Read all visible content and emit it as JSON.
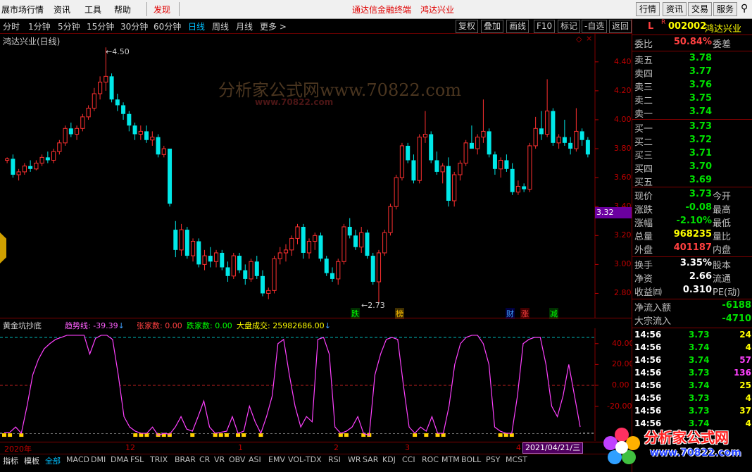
{
  "menu": {
    "items": [
      "展市场行情",
      "资讯",
      "工具",
      "帮助"
    ],
    "discover": "发现",
    "center_links": [
      "通达信金融终端",
      "鸿达兴业"
    ],
    "right_buttons": [
      "行情",
      "资讯",
      "交易",
      "服务"
    ]
  },
  "toolbar": {
    "periods": [
      "分时",
      "1分钟",
      "5分钟",
      "15分钟",
      "30分钟",
      "60分钟",
      "日线",
      "周线",
      "月线",
      "更多 >"
    ],
    "active_period": "日线",
    "right_buttons": [
      "复权",
      "叠加",
      "画线",
      "F10",
      "标记",
      "-自选",
      "返回"
    ]
  },
  "main_chart": {
    "title": "鸿达兴业(日线)",
    "watermark": "分析家公式网www.70822.com",
    "watermark_sub": "www.70822.com",
    "high_label": "4.50",
    "low_label": "2.73",
    "price_marker": "3.32",
    "event_labels": [
      "跌",
      "榜",
      "财",
      "涨",
      "减"
    ],
    "y_ticks": [
      "4.40",
      "4.20",
      "4.00",
      "3.80",
      "3.60",
      "3.40",
      "3.20",
      "3.00",
      "2.80"
    ]
  },
  "chart_data": {
    "type": "candlestick",
    "ylim": [
      2.7,
      4.55
    ],
    "candles": [
      [
        3.72,
        3.74,
        3.7,
        3.73
      ],
      [
        3.73,
        3.76,
        3.6,
        3.62
      ],
      [
        3.62,
        3.66,
        3.58,
        3.64
      ],
      [
        3.64,
        3.7,
        3.62,
        3.68
      ],
      [
        3.68,
        3.72,
        3.64,
        3.66
      ],
      [
        3.66,
        3.72,
        3.65,
        3.7
      ],
      [
        3.7,
        3.76,
        3.68,
        3.74
      ],
      [
        3.74,
        3.78,
        3.7,
        3.72
      ],
      [
        3.72,
        3.8,
        3.7,
        3.78
      ],
      [
        3.78,
        3.86,
        3.76,
        3.84
      ],
      [
        3.84,
        3.96,
        3.82,
        3.94
      ],
      [
        3.94,
        3.98,
        3.88,
        3.9
      ],
      [
        3.9,
        3.96,
        3.86,
        3.94
      ],
      [
        3.94,
        4.04,
        3.92,
        4.02
      ],
      [
        4.02,
        4.1,
        4.0,
        4.08
      ],
      [
        4.08,
        4.22,
        4.06,
        4.18
      ],
      [
        4.18,
        4.3,
        4.14,
        4.26
      ],
      [
        4.26,
        4.5,
        4.2,
        4.3
      ],
      [
        4.3,
        4.32,
        4.12,
        4.14
      ],
      [
        4.14,
        4.18,
        4.06,
        4.1
      ],
      [
        4.1,
        4.12,
        4.0,
        4.04
      ],
      [
        4.04,
        4.06,
        3.92,
        3.96
      ],
      [
        3.96,
        3.98,
        3.86,
        3.9
      ],
      [
        3.9,
        3.96,
        3.86,
        3.92
      ],
      [
        3.92,
        3.96,
        3.84,
        3.86
      ],
      [
        3.86,
        3.92,
        3.82,
        3.88
      ],
      [
        3.88,
        3.9,
        3.74,
        3.76
      ],
      [
        3.76,
        3.82,
        3.74,
        3.8
      ],
      [
        3.8,
        3.8,
        3.4,
        3.42
      ],
      [
        3.24,
        3.3,
        3.05,
        3.1
      ],
      [
        3.1,
        3.28,
        3.06,
        3.24
      ],
      [
        3.24,
        3.26,
        3.04,
        3.06
      ],
      [
        3.06,
        3.18,
        3.02,
        3.16
      ],
      [
        3.16,
        3.18,
        2.98,
        3.0
      ],
      [
        3.0,
        3.1,
        2.96,
        3.06
      ],
      [
        3.06,
        3.12,
        2.98,
        3.02
      ],
      [
        3.02,
        3.1,
        2.98,
        3.08
      ],
      [
        3.08,
        3.1,
        2.96,
        2.98
      ],
      [
        2.98,
        3.02,
        2.88,
        2.92
      ],
      [
        2.92,
        3.08,
        2.9,
        3.06
      ],
      [
        3.06,
        3.08,
        2.94,
        2.96
      ],
      [
        2.96,
        3.0,
        2.86,
        2.9
      ],
      [
        2.9,
        3.04,
        2.88,
        3.02
      ],
      [
        3.02,
        3.06,
        2.9,
        2.92
      ],
      [
        2.92,
        2.96,
        2.78,
        2.8
      ],
      [
        2.8,
        2.84,
        2.76,
        2.82
      ],
      [
        2.82,
        3.06,
        2.8,
        3.04
      ],
      [
        3.04,
        3.12,
        3.0,
        3.08
      ],
      [
        3.08,
        3.14,
        3.02,
        3.1
      ],
      [
        3.1,
        3.2,
        3.06,
        3.18
      ],
      [
        3.18,
        3.28,
        3.14,
        3.26
      ],
      [
        3.26,
        3.28,
        3.04,
        3.08
      ],
      [
        3.08,
        3.18,
        3.04,
        3.16
      ],
      [
        3.16,
        3.22,
        3.1,
        3.2
      ],
      [
        3.2,
        3.22,
        3.02,
        3.04
      ],
      [
        3.04,
        3.06,
        2.92,
        2.94
      ],
      [
        2.94,
        2.98,
        2.88,
        2.9
      ],
      [
        2.9,
        3.04,
        2.86,
        3.02
      ],
      [
        3.02,
        3.28,
        3.0,
        3.26
      ],
      [
        3.26,
        3.32,
        3.18,
        3.2
      ],
      [
        3.2,
        3.24,
        3.1,
        3.12
      ],
      [
        3.12,
        3.26,
        3.08,
        3.22
      ],
      [
        3.22,
        3.24,
        3.04,
        3.06
      ],
      [
        3.06,
        3.08,
        2.86,
        2.88
      ],
      [
        2.88,
        3.1,
        2.73,
        3.08
      ],
      [
        3.08,
        3.24,
        3.06,
        3.22
      ],
      [
        3.22,
        3.42,
        3.2,
        3.4
      ],
      [
        3.4,
        3.62,
        3.38,
        3.6
      ],
      [
        3.6,
        3.84,
        3.58,
        3.82
      ],
      [
        3.82,
        3.84,
        3.7,
        3.72
      ],
      [
        3.72,
        3.76,
        3.56,
        3.58
      ],
      [
        3.58,
        3.9,
        3.56,
        3.88
      ],
      [
        3.88,
        4.06,
        3.84,
        3.9
      ],
      [
        3.9,
        3.92,
        3.7,
        3.72
      ],
      [
        3.72,
        3.78,
        3.62,
        3.64
      ],
      [
        3.64,
        3.7,
        3.56,
        3.68
      ],
      [
        3.68,
        3.74,
        3.4,
        3.44
      ],
      [
        3.44,
        3.64,
        3.4,
        3.62
      ],
      [
        3.62,
        3.72,
        3.58,
        3.7
      ],
      [
        3.7,
        3.86,
        3.68,
        3.84
      ],
      [
        3.84,
        3.96,
        3.82,
        3.8
      ],
      [
        3.8,
        3.9,
        3.76,
        3.88
      ],
      [
        3.88,
        4.14,
        3.84,
        3.92
      ],
      [
        3.92,
        3.94,
        3.74,
        3.76
      ],
      [
        3.76,
        3.78,
        3.62,
        3.66
      ],
      [
        3.66,
        3.74,
        3.6,
        3.72
      ],
      [
        3.72,
        3.76,
        3.64,
        3.66
      ],
      [
        3.66,
        3.7,
        3.48,
        3.5
      ],
      [
        3.5,
        3.58,
        3.48,
        3.54
      ],
      [
        3.54,
        3.56,
        3.5,
        3.52
      ],
      [
        3.52,
        3.84,
        3.5,
        3.82
      ],
      [
        3.82,
        4.02,
        3.8,
        3.94
      ],
      [
        3.94,
        4.06,
        3.86,
        3.9
      ],
      [
        3.9,
        4.28,
        3.88,
        4.06
      ],
      [
        4.06,
        4.08,
        3.82,
        3.84
      ],
      [
        3.84,
        3.9,
        3.8,
        3.88
      ],
      [
        3.88,
        4.0,
        3.82,
        3.84
      ],
      [
        3.84,
        3.88,
        3.76,
        3.8
      ],
      [
        3.8,
        4.08,
        3.78,
        3.92
      ],
      [
        3.92,
        3.94,
        3.82,
        3.86
      ],
      [
        3.86,
        3.88,
        3.74,
        3.76
      ]
    ]
  },
  "indicator": {
    "name": "黄金坑抄底",
    "trend_label": "趋势线: -39.39",
    "up_label": "张家数: 0.00",
    "down_label": "跌家数: 0.00",
    "vol_label": "大盘成交: 25982686.00",
    "y_ticks": [
      "40.00",
      "20.00",
      "0.00",
      "-20.00"
    ],
    "ylim": [
      -48,
      52
    ],
    "trend": [
      -45,
      -45,
      -40,
      -46,
      -20,
      10,
      25,
      35,
      40,
      44,
      46,
      48,
      48,
      48,
      48,
      30,
      45,
      48,
      48,
      44,
      10,
      -30,
      -40,
      -44,
      -46,
      -46,
      -40,
      -48,
      -46,
      -47,
      -40,
      -30,
      -42,
      -44,
      -30,
      -15,
      -40,
      -46,
      -45,
      -44,
      -30,
      -46,
      -44,
      -20,
      -35,
      -46,
      -30,
      -10,
      40,
      44,
      10,
      -20,
      -40,
      -30,
      -35,
      44,
      46,
      30,
      -40,
      -46,
      -44,
      -40,
      -30,
      -46,
      -48,
      10,
      30,
      44,
      46,
      44,
      0,
      -40,
      -46,
      -40,
      -44,
      -30,
      -46,
      -46,
      -20,
      20,
      40,
      46,
      48,
      48,
      40,
      20,
      -40,
      -44,
      -46,
      -46,
      -10,
      40,
      44,
      46,
      46,
      20,
      -20,
      -30,
      -10,
      20,
      -10,
      -40
    ]
  },
  "x_labels": [
    "2020年",
    "12",
    "1",
    "2",
    "3",
    "4"
  ],
  "date_box": "2021/04/21/三",
  "tabs": [
    "指标",
    "模板",
    "全部",
    "MACD",
    "DMI",
    "DMA",
    "FSL",
    "TRIX",
    "BRAR",
    "CR",
    "VR",
    "OBV",
    "ASI",
    "EMV",
    "VOL-TDX",
    "RSI",
    "WR",
    "SAR",
    "KDJ",
    "CCI",
    "ROC",
    "MTM",
    "BOLL",
    "PSY",
    "MCST"
  ],
  "right_panel": {
    "code_prefix": "L",
    "code_r": "R",
    "code": "002002",
    "name": "鸿达兴业",
    "webi_label": "委比",
    "webi_value": "50.84%",
    "webi_right": "委差",
    "asks": [
      {
        "label": "卖五",
        "price": "3.78"
      },
      {
        "label": "卖四",
        "price": "3.77"
      },
      {
        "label": "卖三",
        "price": "3.76"
      },
      {
        "label": "卖二",
        "price": "3.75"
      },
      {
        "label": "卖一",
        "price": "3.74"
      }
    ],
    "bids": [
      {
        "label": "买一",
        "price": "3.73"
      },
      {
        "label": "买二",
        "price": "3.72"
      },
      {
        "label": "买三",
        "price": "3.71"
      },
      {
        "label": "买四",
        "price": "3.70"
      },
      {
        "label": "买五",
        "price": "3.69"
      }
    ],
    "stats": [
      {
        "label": "现价",
        "value": "3.73",
        "right": "今开",
        "color": "#00e000"
      },
      {
        "label": "涨跌",
        "value": "-0.08",
        "right": "最高",
        "color": "#00e000"
      },
      {
        "label": "涨幅",
        "value": "-2.10%",
        "right": "最低",
        "color": "#00e000"
      },
      {
        "label": "总量",
        "value": "968235",
        "right": "量比",
        "color": "#ffff00"
      },
      {
        "label": "外盘",
        "value": "401187",
        "right": "内盘",
        "color": "#ff4040"
      }
    ],
    "stats2": [
      {
        "label": "换手",
        "value": "3.35%",
        "right": "股本",
        "color": "#ffffff"
      },
      {
        "label": "净资",
        "value": "2.66",
        "right": "流通",
        "color": "#ffffff"
      },
      {
        "label": "收益㈣",
        "value": "0.310",
        "right": "PE(动)",
        "color": "#ffffff"
      }
    ],
    "flows": [
      {
        "label": "净流入额",
        "value": "-6188",
        "color": "#00e000"
      },
      {
        "label": "大宗流入",
        "value": "-4710",
        "color": "#00e000"
      }
    ],
    "ticks": [
      {
        "time": "14:56",
        "price": "3.73",
        "vol": "24",
        "pc": "#00e000",
        "vc": "#ffff00"
      },
      {
        "time": "14:56",
        "price": "3.74",
        "vol": "4",
        "pc": "#00e000",
        "vc": "#ffff00"
      },
      {
        "time": "14:56",
        "price": "3.74",
        "vol": "57",
        "pc": "#00e000",
        "vc": "#ff40ff"
      },
      {
        "time": "14:56",
        "price": "3.73",
        "vol": "136",
        "pc": "#00e000",
        "vc": "#ff40ff"
      },
      {
        "time": "14:56",
        "price": "3.74",
        "vol": "25",
        "pc": "#00e000",
        "vc": "#ffff00"
      },
      {
        "time": "14:56",
        "price": "3.73",
        "vol": "4",
        "pc": "#00e000",
        "vc": "#ffff00"
      },
      {
        "time": "14:56",
        "price": "3.73",
        "vol": "37",
        "pc": "#00e000",
        "vc": "#ffff00"
      },
      {
        "time": "14:56",
        "price": "3.74",
        "vol": "4",
        "pc": "#00e000",
        "vc": "#ffff00"
      }
    ]
  },
  "logo": {
    "text": "分析家公式网",
    "url": "www.70822.com"
  }
}
